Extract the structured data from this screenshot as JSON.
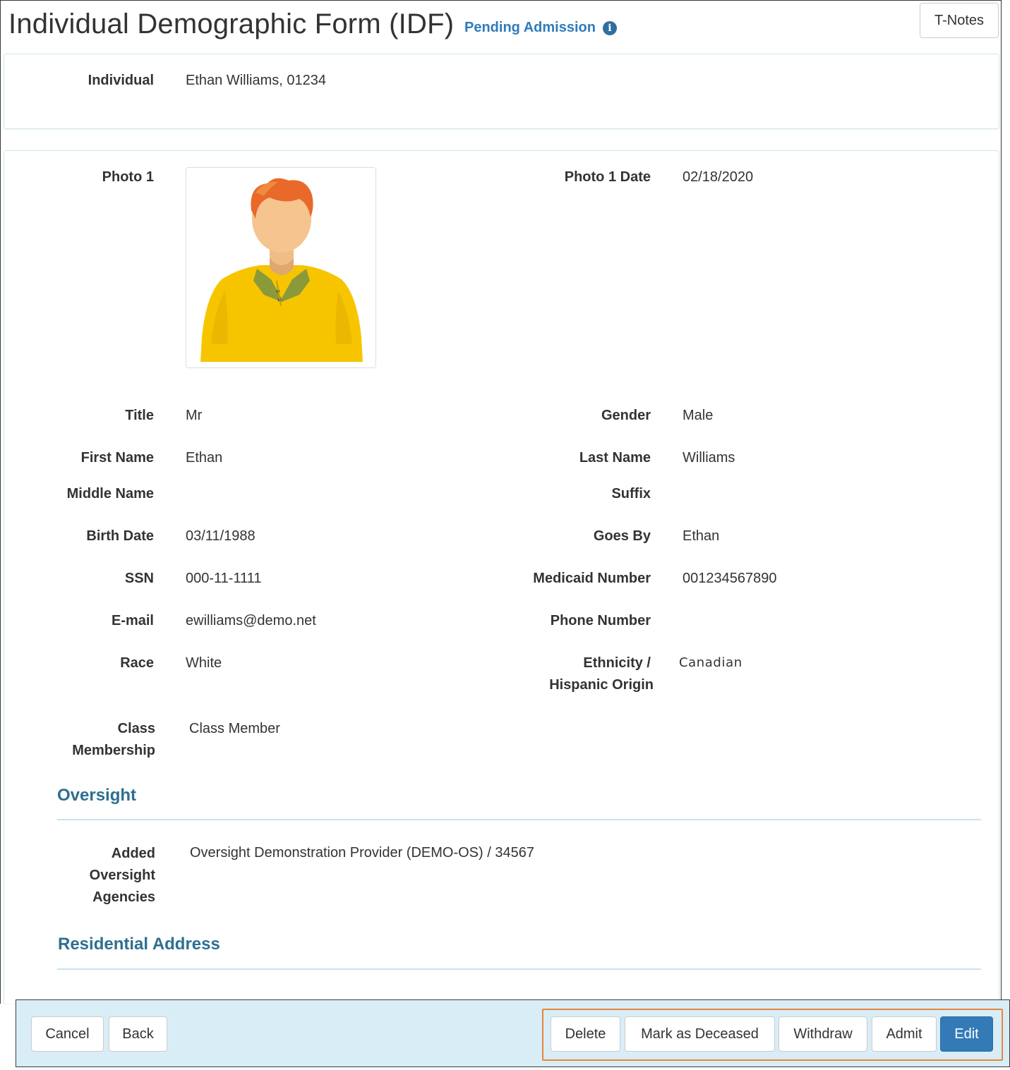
{
  "header": {
    "title": "Individual Demographic Form (IDF)",
    "status": "Pending Admission",
    "status_icon": "info-icon",
    "tnotes_label": "T-Notes"
  },
  "individual": {
    "label": "Individual",
    "value": "Ethan Williams, 01234"
  },
  "photo": {
    "label": "Photo 1",
    "date_label": "Photo 1 Date",
    "date_value": "02/18/2020"
  },
  "fields": {
    "title": {
      "label": "Title",
      "value": "Mr"
    },
    "gender": {
      "label": "Gender",
      "value": "Male"
    },
    "first_name": {
      "label": "First Name",
      "value": "Ethan"
    },
    "last_name": {
      "label": "Last Name",
      "value": "Williams"
    },
    "middle_name": {
      "label": "Middle Name",
      "value": ""
    },
    "suffix": {
      "label": "Suffix",
      "value": ""
    },
    "birth_date": {
      "label": "Birth Date",
      "value": "03/11/1988"
    },
    "goes_by": {
      "label": "Goes By",
      "value": "Ethan"
    },
    "ssn": {
      "label": "SSN",
      "value": "000-11-1111"
    },
    "medicaid": {
      "label": "Medicaid Number",
      "value": "001234567890"
    },
    "email": {
      "label": "E-mail",
      "value": "ewilliams@demo.net"
    },
    "phone": {
      "label": "Phone Number",
      "value": ""
    },
    "race": {
      "label": "Race",
      "value": "White"
    },
    "ethnicity": {
      "label_line1": "Ethnicity /",
      "label_line2": "Hispanic Origin",
      "value": "Canadian"
    },
    "class_membership": {
      "label_line1": "Class",
      "label_line2": "Membership",
      "value": "Class Member"
    }
  },
  "oversight": {
    "section_title": "Oversight",
    "label_line1": "Added",
    "label_line2": "Oversight",
    "label_line3": "Agencies",
    "value": "Oversight Demonstration Provider (DEMO-OS) / 34567"
  },
  "residential": {
    "section_title": "Residential Address"
  },
  "footer": {
    "cancel": "Cancel",
    "back": "Back",
    "delete": "Delete",
    "mark_deceased": "Mark as Deceased",
    "withdraw": "Withdraw",
    "admit": "Admit",
    "edit": "Edit"
  }
}
